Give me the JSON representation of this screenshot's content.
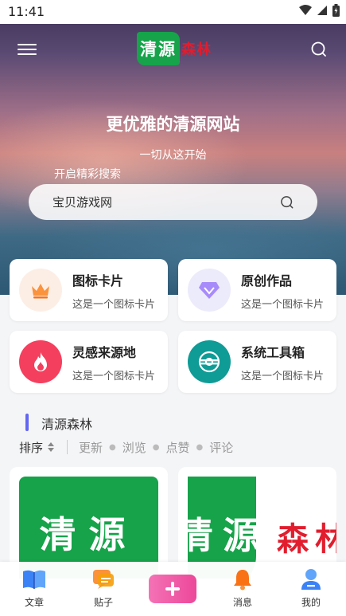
{
  "status": {
    "time": "11:41"
  },
  "header": {
    "logo_green": "清源",
    "logo_red": "森林"
  },
  "hero": {
    "title": "更优雅的清源网站",
    "subtitle": "一切从这开始",
    "search_hint": "开启精彩搜索",
    "search_value": "宝贝游戏网"
  },
  "cards": [
    {
      "title": "图标卡片",
      "desc": "这是一个图标卡片",
      "icon": "crown-icon",
      "color": "#fb923c"
    },
    {
      "title": "原创作品",
      "desc": "这是一个图标卡片",
      "icon": "diamond-icon",
      "color": "#8b5cf6"
    },
    {
      "title": "灵感来源地",
      "desc": "这是一个图标卡片",
      "icon": "flame-icon",
      "color": "#f43f5e"
    },
    {
      "title": "系统工具箱",
      "desc": "这是一个图标卡片",
      "icon": "tool-icon",
      "color": "#0d9488"
    }
  ],
  "section": {
    "title": "清源森林"
  },
  "sort": {
    "label": "排序",
    "options": [
      "更新",
      "浏览",
      "点赞",
      "评论"
    ]
  },
  "posts": [
    {
      "image_text": "清源"
    },
    {
      "image_text_green": "清源",
      "image_text_red": "森林"
    }
  ],
  "tabs": [
    {
      "label": "文章",
      "icon": "book-icon"
    },
    {
      "label": "贴子",
      "icon": "chat-icon"
    },
    {
      "label": "",
      "icon": "plus-icon"
    },
    {
      "label": "消息",
      "icon": "bell-icon"
    },
    {
      "label": "我的",
      "icon": "user-icon"
    }
  ]
}
